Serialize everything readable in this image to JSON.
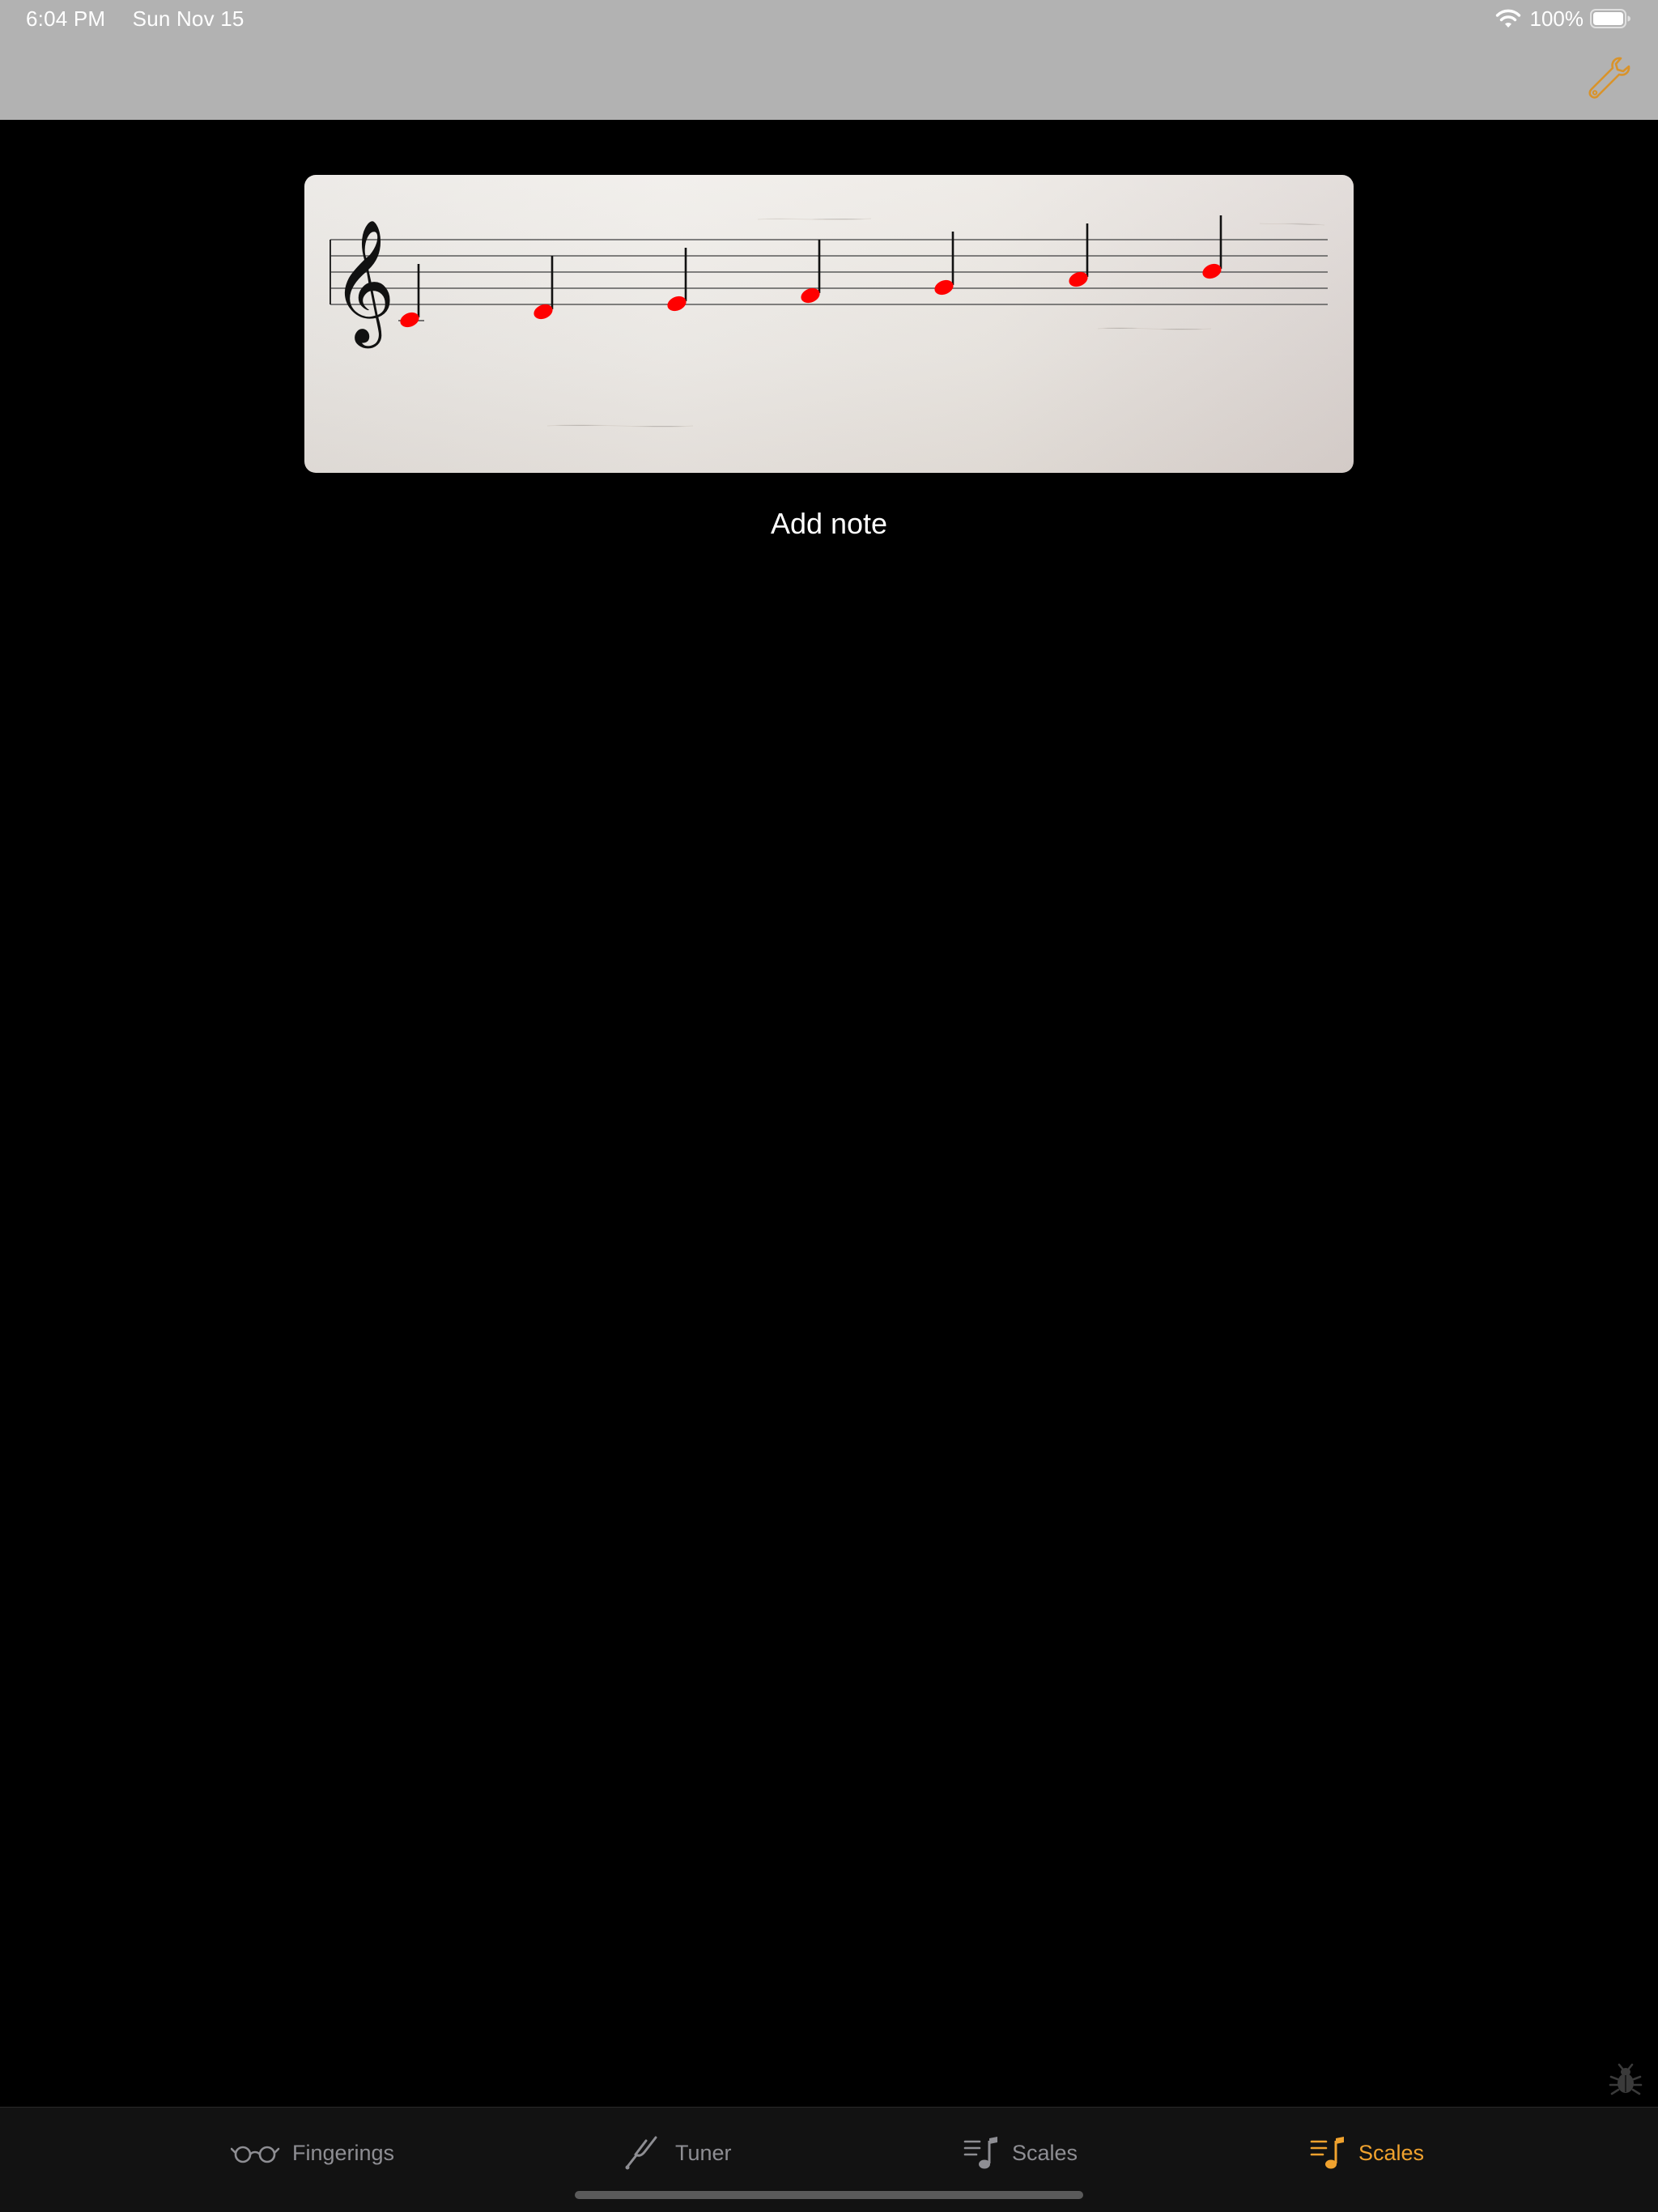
{
  "status_bar": {
    "time": "6:04 PM",
    "date": "Sun Nov 15",
    "battery": "100%"
  },
  "nav": {
    "settings_icon": "wrench-icon",
    "accent_color": "#f0a22e"
  },
  "staff": {
    "clef": "treble-clef",
    "note_color": "#ff0000",
    "notes": [
      "C4",
      "D4",
      "E4",
      "F4",
      "G4",
      "A4",
      "B4"
    ]
  },
  "actions": {
    "add_note_label": "Add note"
  },
  "tabs": [
    {
      "label": "Fingerings",
      "icon": "glasses-icon",
      "active": false
    },
    {
      "label": "Tuner",
      "icon": "tuning-fork-icon",
      "active": false
    },
    {
      "label": "Scales",
      "icon": "music-list-icon",
      "active": false
    },
    {
      "label": "Scales",
      "icon": "music-list-icon",
      "active": true
    }
  ]
}
